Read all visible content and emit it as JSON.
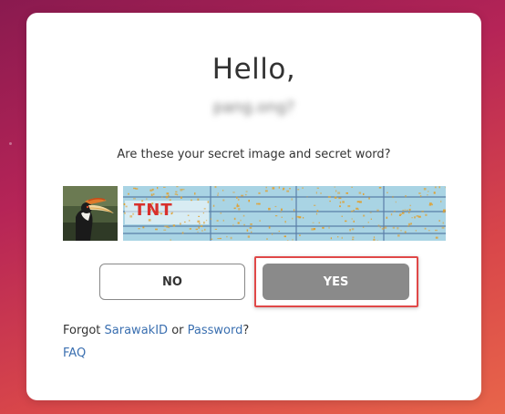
{
  "dialog": {
    "title": "Hello,",
    "username": "pang.ong?",
    "question": "Are these your secret image and secret word?",
    "secret_image": {
      "icon": "hornbill-bird-image"
    },
    "secret_word": {
      "text": "TNT"
    },
    "buttons": {
      "no_label": "NO",
      "yes_label": "YES"
    },
    "forgot": {
      "prefix": "Forgot",
      "sarawakid_link": "SarawakID",
      "or_text": "or",
      "password_link": "Password",
      "suffix": "?"
    },
    "faq_link": "FAQ"
  },
  "colors": {
    "link": "#3a6fb0",
    "yes_button": "#8a8a8a",
    "highlight_border": "#e04848",
    "secret_word_text": "#d8302c"
  }
}
